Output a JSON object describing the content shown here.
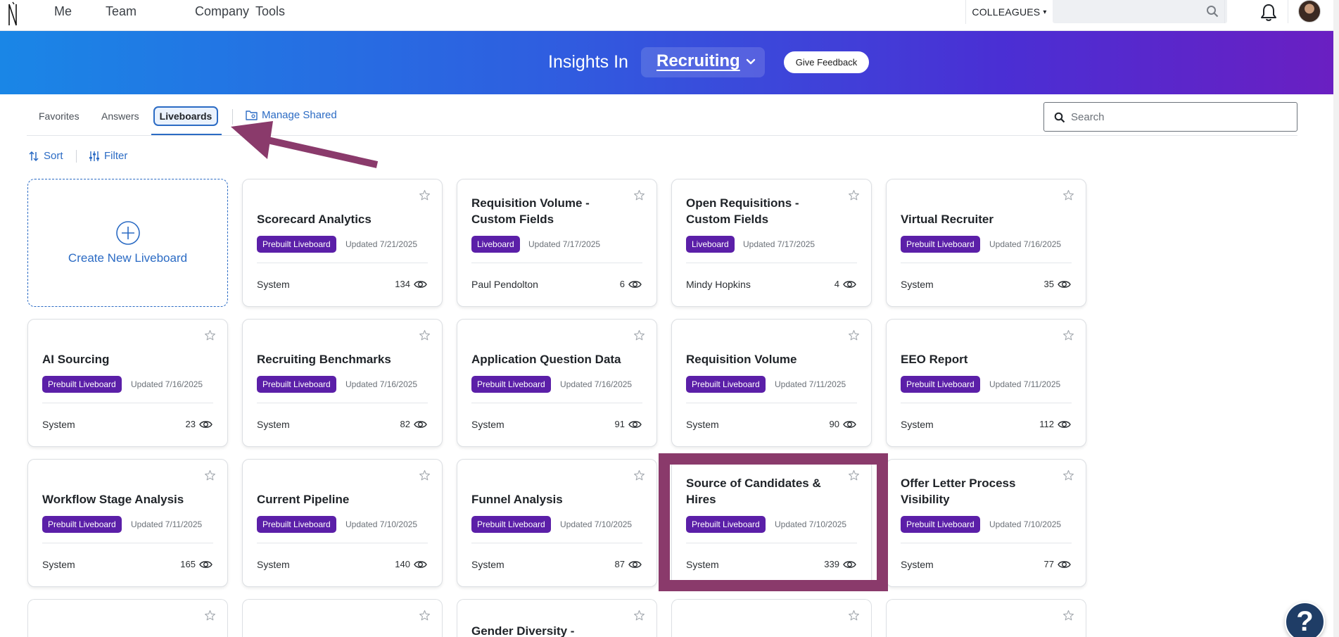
{
  "topnav": {
    "links": [
      "Me",
      "Team",
      "Company",
      "Tools"
    ],
    "colleagues_label": "COLLEAGUES",
    "search_placeholder": ""
  },
  "banner": {
    "title": "Insights In",
    "domain": "Recruiting",
    "feedback_label": "Give Feedback"
  },
  "tabs": {
    "favorites": "Favorites",
    "answers": "Answers",
    "liveboards": "Liveboards",
    "active": "Liveboards",
    "manage_shared": "Manage Shared"
  },
  "search": {
    "placeholder": "Search"
  },
  "tools": {
    "sort": "Sort",
    "filter": "Filter"
  },
  "create_card": {
    "label": "Create New Liveboard"
  },
  "cards": [
    {
      "title": "Scorecard Analytics",
      "badge": "Prebuilt Liveboard",
      "updated": "Updated 7/21/2025",
      "owner": "System",
      "views": "134"
    },
    {
      "title": "Requisition Volume - Custom Fields",
      "badge": "Liveboard",
      "updated": "Updated 7/17/2025",
      "owner": "Paul Pendolton",
      "views": "6"
    },
    {
      "title": "Open Requisitions - Custom Fields",
      "badge": "Liveboard",
      "updated": "Updated 7/17/2025",
      "owner": "Mindy Hopkins",
      "views": "4"
    },
    {
      "title": "Virtual Recruiter",
      "badge": "Prebuilt Liveboard",
      "updated": "Updated 7/16/2025",
      "owner": "System",
      "views": "35"
    },
    {
      "title": "AI Sourcing",
      "badge": "Prebuilt Liveboard",
      "updated": "Updated 7/16/2025",
      "owner": "System",
      "views": "23"
    },
    {
      "title": "Recruiting Benchmarks",
      "badge": "Prebuilt Liveboard",
      "updated": "Updated 7/16/2025",
      "owner": "System",
      "views": "82"
    },
    {
      "title": "Application Question Data",
      "badge": "Prebuilt Liveboard",
      "updated": "Updated 7/16/2025",
      "owner": "System",
      "views": "91"
    },
    {
      "title": "Requisition Volume",
      "badge": "Prebuilt Liveboard",
      "updated": "Updated 7/11/2025",
      "owner": "System",
      "views": "90"
    },
    {
      "title": "EEO Report",
      "badge": "Prebuilt Liveboard",
      "updated": "Updated 7/11/2025",
      "owner": "System",
      "views": "112"
    },
    {
      "title": "Workflow Stage Analysis",
      "badge": "Prebuilt Liveboard",
      "updated": "Updated 7/11/2025",
      "owner": "System",
      "views": "165"
    },
    {
      "title": "Current Pipeline",
      "badge": "Prebuilt Liveboard",
      "updated": "Updated 7/10/2025",
      "owner": "System",
      "views": "140"
    },
    {
      "title": "Funnel Analysis",
      "badge": "Prebuilt Liveboard",
      "updated": "Updated 7/10/2025",
      "owner": "System",
      "views": "87"
    },
    {
      "title": "Source of Candidates & Hires",
      "badge": "Prebuilt Liveboard",
      "updated": "Updated 7/10/2025",
      "owner": "System",
      "views": "339"
    },
    {
      "title": "Offer Letter Process Visibility",
      "badge": "Prebuilt Liveboard",
      "updated": "Updated 7/10/2025",
      "owner": "System",
      "views": "77"
    }
  ],
  "partial_cards": [
    "",
    "",
    "Gender Diversity -",
    "",
    ""
  ],
  "help_label": "?",
  "colors": {
    "accent": "#2b6bc4",
    "badge": "#5b1fa8",
    "annotation": "#8a3a6b",
    "banner_start": "#1a86e6",
    "banner_end": "#6a1fc2"
  }
}
